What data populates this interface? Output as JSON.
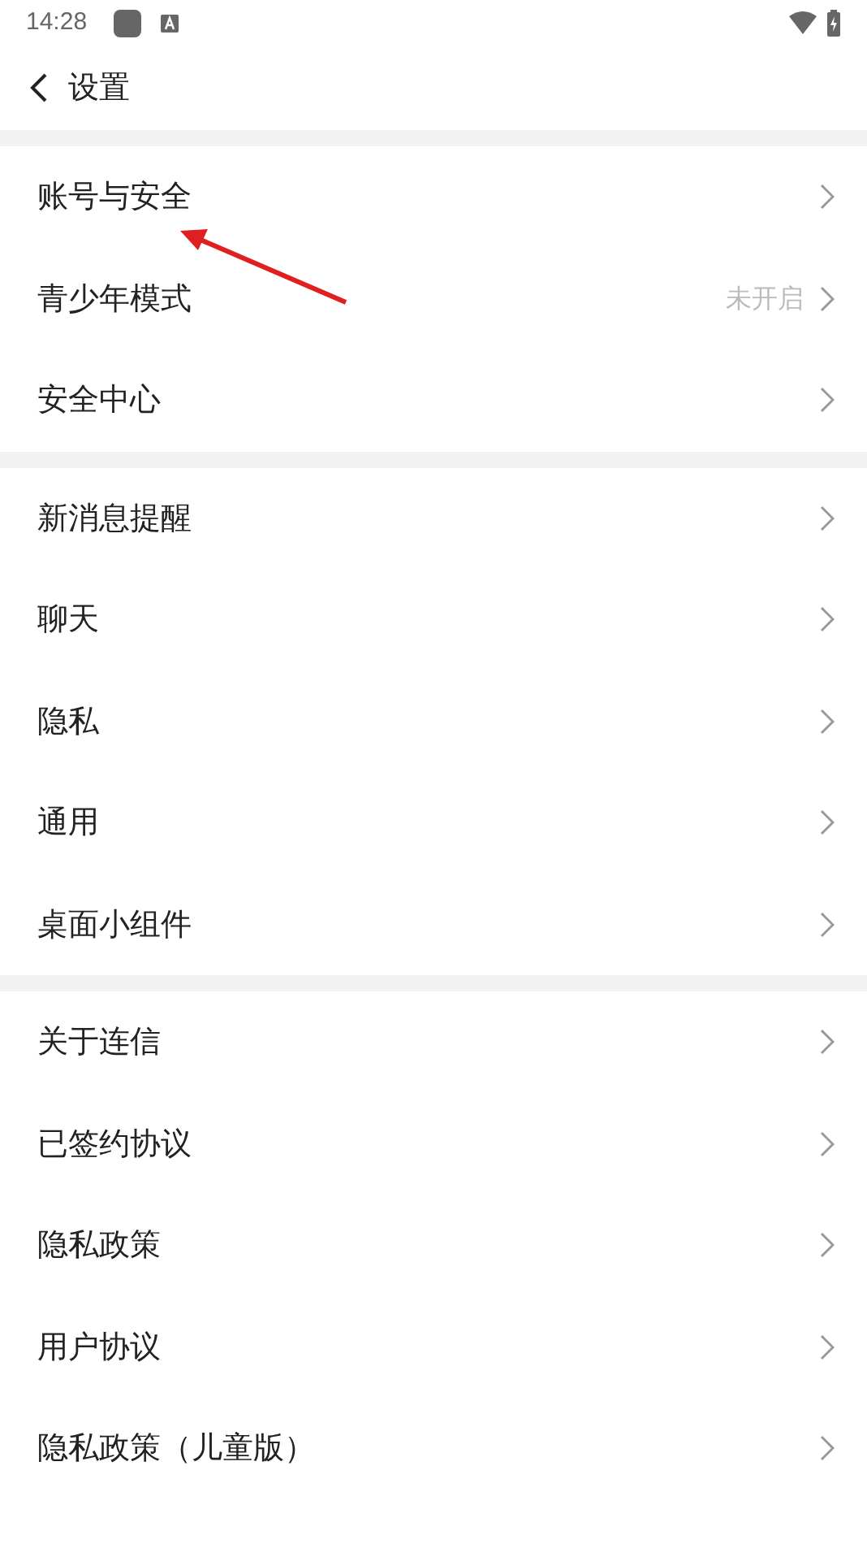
{
  "status_bar": {
    "time": "14:28"
  },
  "header": {
    "title": "设置"
  },
  "groups": [
    {
      "items": [
        {
          "label": "账号与安全"
        },
        {
          "label": "青少年模式",
          "value": "未开启"
        },
        {
          "label": "安全中心"
        }
      ]
    },
    {
      "items": [
        {
          "label": "新消息提醒"
        },
        {
          "label": "聊天"
        },
        {
          "label": "隐私"
        },
        {
          "label": "通用"
        },
        {
          "label": "桌面小组件"
        }
      ]
    },
    {
      "items": [
        {
          "label": "关于连信"
        },
        {
          "label": "已签约协议"
        },
        {
          "label": "隐私政策"
        },
        {
          "label": "用户协议"
        },
        {
          "label": "隐私政策（儿童版）"
        }
      ]
    }
  ]
}
